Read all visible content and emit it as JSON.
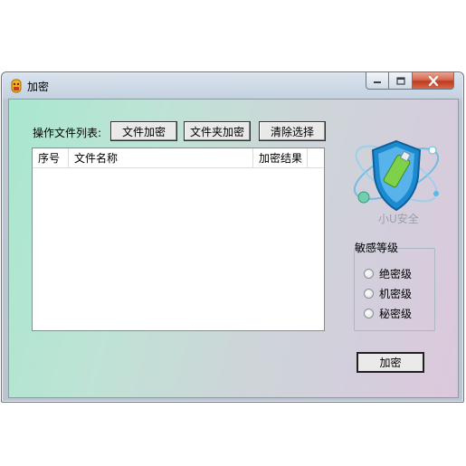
{
  "window": {
    "title": "加密"
  },
  "toolbar": {
    "files_label": "操作文件列表:",
    "encrypt_file_label": "文件加密",
    "encrypt_folder_label": "文件夹加密",
    "clear_selection_label": "清除选择"
  },
  "file_list": {
    "columns": [
      "序号",
      "文件名称",
      "加密结果"
    ],
    "rows": []
  },
  "brand": {
    "name": "小U安全"
  },
  "sensitivity": {
    "title": "敏感等级",
    "options": [
      {
        "label": "绝密级",
        "selected": false
      },
      {
        "label": "机密级",
        "selected": false
      },
      {
        "label": "秘密级",
        "selected": false
      }
    ]
  },
  "actions": {
    "encrypt_label": "加密"
  },
  "colors": {
    "client_gradient_start": "#a9e7cf",
    "client_gradient_end": "#dcc8dc",
    "close_button": "#c0391c",
    "logo_shield": "#1c8ad0"
  }
}
